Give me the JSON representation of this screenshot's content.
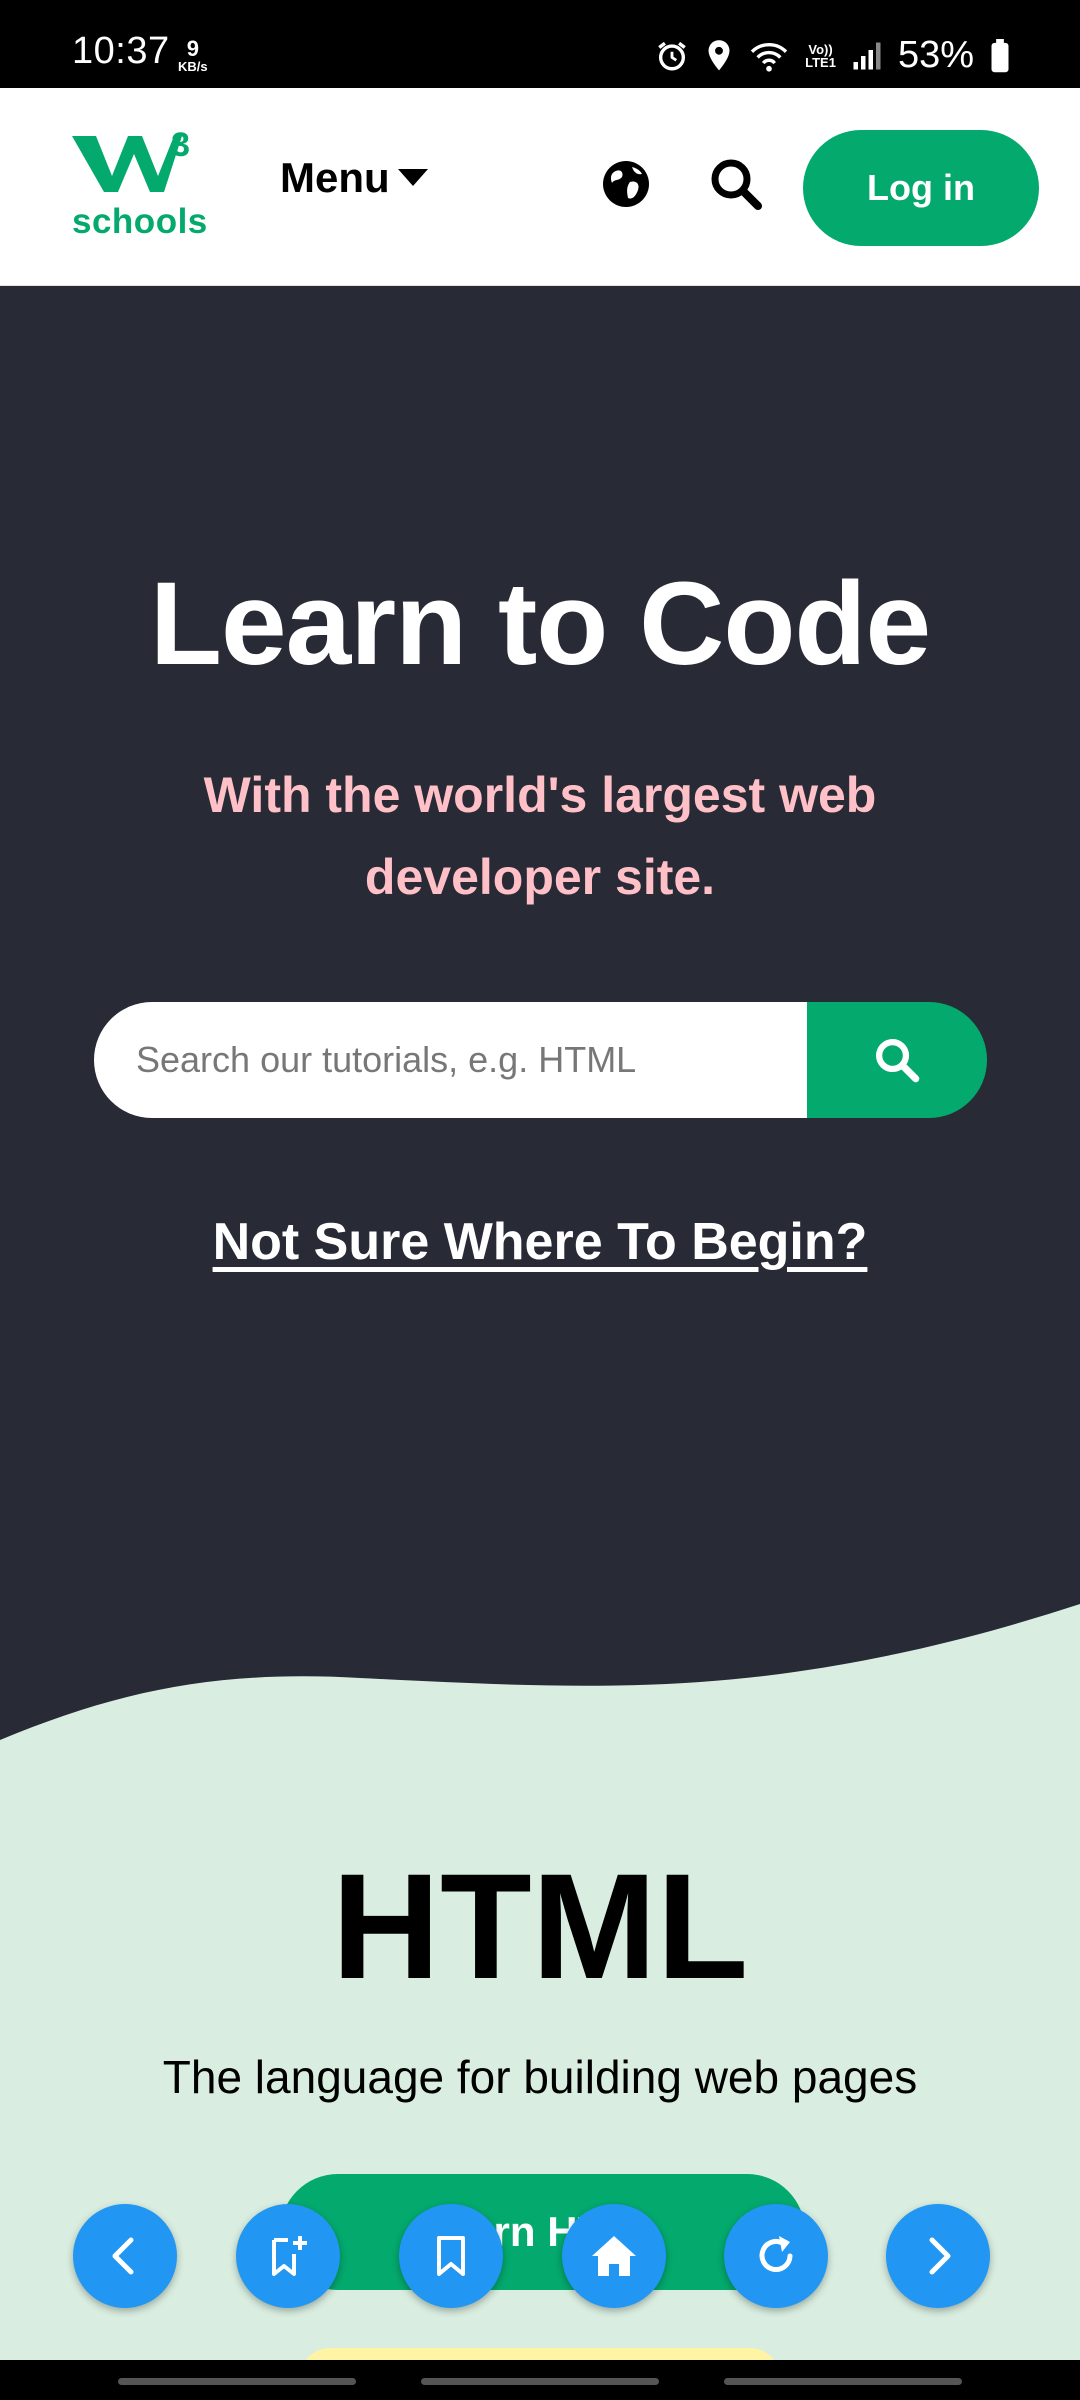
{
  "status_bar": {
    "time": "10:37",
    "speed_value": "9",
    "speed_unit": "KB/s",
    "lte_top": "Vo))",
    "lte_bottom": "LTE1",
    "battery": "53%",
    "icons": [
      "alarm-icon",
      "location-icon",
      "wifi-icon",
      "volte-icon",
      "signal-icon",
      "battery-icon"
    ]
  },
  "header": {
    "logo_mark": "3",
    "logo_text": "schools",
    "menu_label": "Menu",
    "login_label": "Log in",
    "icons": [
      "globe-icon",
      "search-icon",
      "caret-down-icon"
    ]
  },
  "hero": {
    "title": "Learn to Code",
    "subtitle": "With the world's largest web developer site.",
    "search_placeholder": "Search our tutorials, e.g. HTML",
    "cta_link": "Not Sure Where To Begin?"
  },
  "html_section": {
    "title": "HTML",
    "subtitle": "The language for building web pages",
    "button_label": "Learn HTML"
  },
  "browser_controls": [
    "back-icon",
    "add-bookmark-icon",
    "bookmarks-icon",
    "home-icon",
    "refresh-icon",
    "forward-icon"
  ],
  "colors": {
    "brand_green": "#04AA6D",
    "hero_bg": "#282A35",
    "hero_subtitle": "#FFC0C7",
    "section_bg": "#D9EEE1",
    "fab_blue": "#2196F3"
  }
}
